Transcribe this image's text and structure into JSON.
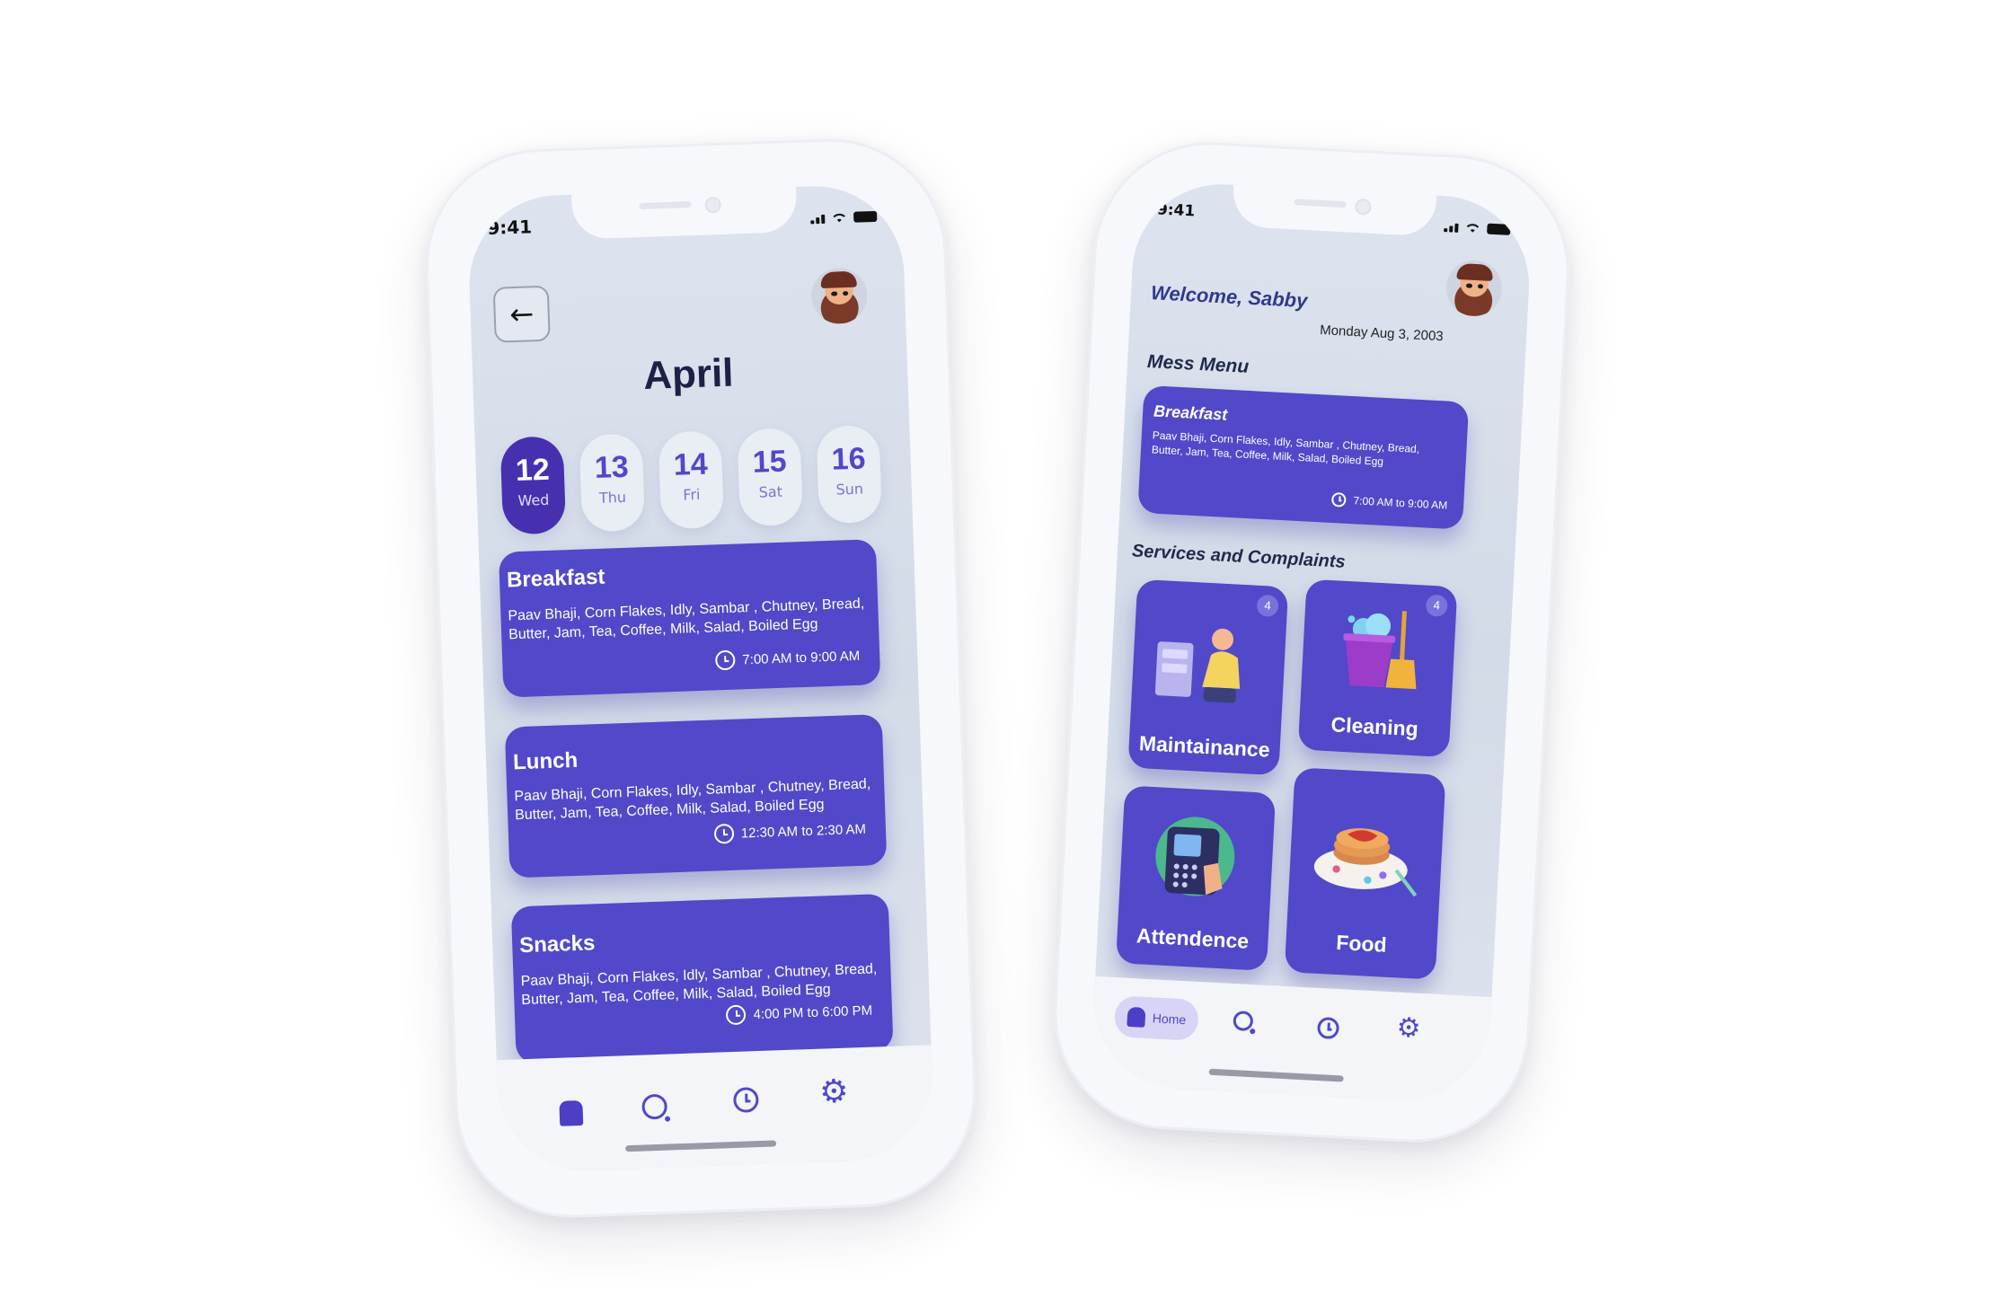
{
  "left_phone": {
    "status_time": "9:41",
    "month": "April",
    "dates": [
      {
        "num": "12",
        "day": "Wed"
      },
      {
        "num": "13",
        "day": "Thu"
      },
      {
        "num": "14",
        "day": "Fri"
      },
      {
        "num": "15",
        "day": "Sat"
      },
      {
        "num": "16",
        "day": "Sun"
      }
    ],
    "meals": [
      {
        "title": "Breakfast",
        "items": "Paav Bhaji, Corn Flakes, Idly, Sambar , Chutney, Bread, Butter, Jam, Tea, Coffee,  Milk, Salad, Boiled Egg",
        "time": "7:00 AM to 9:00 AM"
      },
      {
        "title": "Lunch",
        "items": "Paav Bhaji, Corn Flakes, Idly, Sambar , Chutney, Bread, Butter, Jam, Tea, Coffee,  Milk, Salad, Boiled Egg",
        "time": "12:30 AM to 2:30 AM"
      },
      {
        "title": "Snacks",
        "items": "Paav Bhaji, Corn Flakes, Idly, Sambar , Chutney, Bread, Butter, Jam, Tea, Coffee,  Milk, Salad, Boiled Egg",
        "time": "4:00 PM to 6:00 PM"
      }
    ],
    "nav_icons": [
      "home-icon",
      "search-icon",
      "clock-icon",
      "gear-icon"
    ]
  },
  "right_phone": {
    "status_time": "9:41",
    "welcome": "Welcome, Sabby",
    "date": "Monday Aug 3, 2003",
    "mess_menu_title": "Mess Menu",
    "breakfast": {
      "title": "Breakfast",
      "items": "Paav Bhaji, Corn Flakes, Idly, Sambar , Chutney, Bread, Butter, Jam, Tea, Coffee,  Milk, Salad, Boiled Egg",
      "time": "7:00 AM to 9:00 AM"
    },
    "services_title": "Services  and Complaints",
    "services": [
      {
        "label": "Maintainance",
        "badge": "4"
      },
      {
        "label": "Cleaning",
        "badge": "4"
      },
      {
        "label": "Attendence"
      },
      {
        "label": "Food"
      }
    ],
    "nav": {
      "home_label": "Home"
    }
  },
  "colors": {
    "card": "#5149c9",
    "active_date": "#4630b0",
    "accent_text": "#5048c9"
  }
}
